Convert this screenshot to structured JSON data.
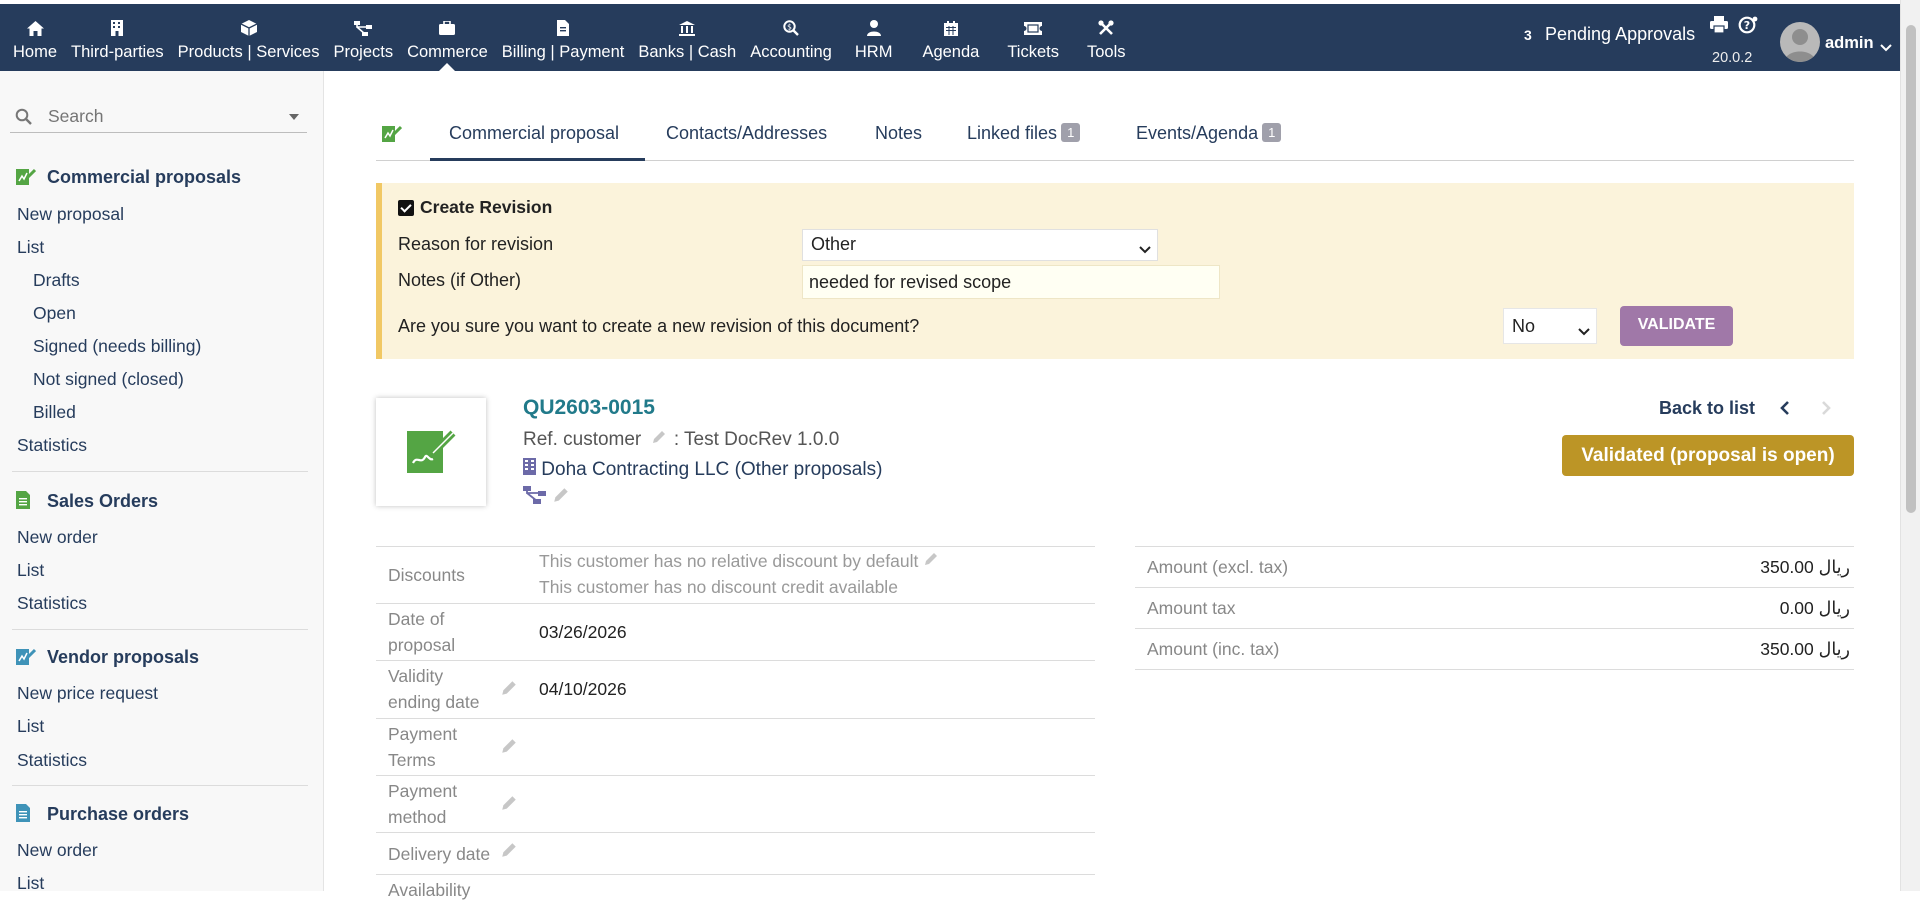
{
  "topbar": {
    "menus": [
      {
        "label": "Home",
        "icon": "home-icon"
      },
      {
        "label": "Third-parties",
        "icon": "building-icon"
      },
      {
        "label": "Products | Services",
        "icon": "box-icon"
      },
      {
        "label": "Projects",
        "icon": "sitemap-icon"
      },
      {
        "label": "Commerce",
        "icon": "briefcase-icon"
      },
      {
        "label": "Billing | Payment",
        "icon": "invoice-icon"
      },
      {
        "label": "Banks | Cash",
        "icon": "bank-icon"
      },
      {
        "label": "Accounting",
        "icon": "search-dollar-icon"
      },
      {
        "label": "HRM",
        "icon": "user-icon"
      },
      {
        "label": "Agenda",
        "icon": "calendar-icon"
      },
      {
        "label": "Tickets",
        "icon": "ticket-icon"
      },
      {
        "label": "Tools",
        "icon": "tools-icon"
      }
    ],
    "pending_count": "3",
    "pending_label": "Pending Approvals",
    "version": "20.0.2",
    "username": "admin"
  },
  "sidebar": {
    "search_placeholder": "Search",
    "sections": [
      {
        "title": "Commercial proposals",
        "links": [
          "New proposal",
          "List",
          "Drafts",
          "Open",
          "Signed (needs billing)",
          "Not signed (closed)",
          "Billed",
          "Statistics"
        ]
      },
      {
        "title": "Sales Orders",
        "links": [
          "New order",
          "List",
          "Statistics"
        ]
      },
      {
        "title": "Vendor proposals",
        "links": [
          "New price request",
          "List",
          "Statistics"
        ]
      },
      {
        "title": "Purchase orders",
        "links": [
          "New order",
          "List"
        ]
      }
    ]
  },
  "tabs": [
    {
      "label": "Commercial proposal"
    },
    {
      "label": "Contacts/Addresses"
    },
    {
      "label": "Notes"
    },
    {
      "label": "Linked files",
      "badge": "1"
    },
    {
      "label": "Events/Agenda",
      "badge": "1"
    }
  ],
  "revision": {
    "title": "Create Revision",
    "reason_label": "Reason for revision",
    "reason_value": "Other",
    "notes_label": "Notes (if Other)",
    "notes_value": "needed for revised scope",
    "confirm_question": "Are you sure you want to create a new revision of this document?",
    "confirm_value": "No",
    "validate_label": "VALIDATE"
  },
  "proposal": {
    "ref": "QU2603-0015",
    "ref_customer_label": "Ref. customer",
    "ref_customer_value": ": Test DocRev 1.0.0",
    "company": "Doha Contracting LLC",
    "other_proposals": "(Other proposals)",
    "back_to_list": "Back to list",
    "status": "Validated (proposal is open)"
  },
  "fields": {
    "discounts_label": "Discounts",
    "discount_line1": "This customer has no relative discount by default",
    "discount_line2": "This customer has no discount credit available",
    "date_label_1": "Date of",
    "date_label_2": "proposal",
    "date_value": "03/26/2026",
    "validity_label_1": "Validity",
    "validity_label_2": "ending date",
    "validity_value": "04/10/2026",
    "payterms_label_1": "Payment",
    "payterms_label_2": "Terms",
    "paymethod_label_1": "Payment",
    "paymethod_label_2": "method",
    "delivery_label": "Delivery date",
    "availability_label": "Availability"
  },
  "amounts": [
    {
      "label": "Amount (excl. tax)",
      "value": "350.00 ريال"
    },
    {
      "label": "Amount tax",
      "value": "0.00 ريال"
    },
    {
      "label": "Amount (inc. tax)",
      "value": "350.00 ريال"
    }
  ],
  "colors": {
    "topbar": "#263c5c",
    "status_badge": "#bc9526",
    "validate_button": "#a078a8",
    "ref_link": "#217a8a",
    "icon_green": "#54a544"
  }
}
